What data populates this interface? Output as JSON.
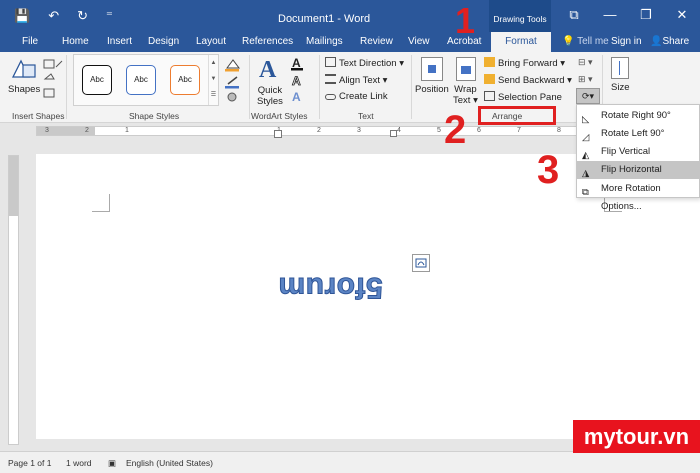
{
  "app": {
    "doc_title": "Document1 - Word",
    "context_group": "Drawing Tools"
  },
  "qat": {
    "save": "💾",
    "undo": "↶",
    "redo": "↻",
    "customize": "⁼"
  },
  "window_controls": {
    "ribbon_display": "⧉",
    "minimize": "—",
    "restore": "❐",
    "close": "✕"
  },
  "tabs": [
    "File",
    "Home",
    "Insert",
    "Design",
    "Layout",
    "References",
    "Mailings",
    "Review",
    "View",
    "Acrobat"
  ],
  "active_tab": "Format",
  "tell_me": "Tell me",
  "sign_in": "Sign in",
  "share": "Share",
  "ribbon": {
    "insert_shapes": {
      "shapes_label": "Shapes",
      "group": "Insert Shapes"
    },
    "shape_styles": {
      "items": [
        "Abc",
        "Abc",
        "Abc"
      ],
      "group": "Shape Styles"
    },
    "wordart": {
      "quick_styles": "Quick",
      "quick_styles2": "Styles",
      "group": "WordArt Styles"
    },
    "text": {
      "text_direction": "Text Direction",
      "align_text": "Align Text",
      "create_link": "Create Link",
      "group": "Text"
    },
    "arrange": {
      "position": "Position",
      "wrap_text": "Wrap",
      "wrap_text2": "Text",
      "bring_forward": "Bring Forward",
      "send_backward": "Send Backward",
      "selection_pane": "Selection Pane",
      "group": "Arrange"
    },
    "size": {
      "label": "Size"
    }
  },
  "ruler": {
    "marks": [
      "3",
      "2",
      "1",
      "1",
      "2",
      "3",
      "4",
      "5",
      "6",
      "7",
      "8",
      "9",
      "10",
      "11"
    ]
  },
  "rotate_menu": {
    "items": [
      {
        "label": "Rotate Right 90°"
      },
      {
        "label": "Rotate Left 90°"
      },
      {
        "label": "Flip Vertical"
      },
      {
        "label": "Flip Horizontal"
      },
      {
        "label": "More Rotation Options..."
      }
    ]
  },
  "document": {
    "wordart_text": "5forum"
  },
  "status": {
    "page": "Page 1 of 1",
    "words": "1 word",
    "language": "English (United States)"
  },
  "annotations": {
    "one": "1",
    "two": "2",
    "three": "3"
  },
  "watermark": "mytour.vn",
  "colors": {
    "ribbon_blue": "#2b579a",
    "annotation_red": "#e02020",
    "wordart_blue": "#5b84c4"
  }
}
